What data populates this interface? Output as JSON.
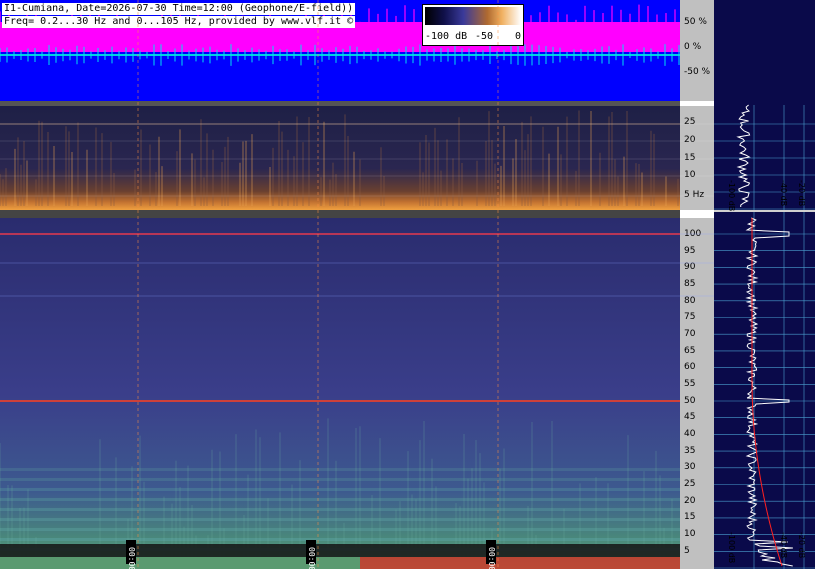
{
  "header": {
    "line1": "I1-Cumiana, Date=2026-07-30 Time=12:00 (Geophone/E-field))",
    "line2": "Freq= 0.2...30 Hz and 0...105 Hz, provided by www.vlf.it ©"
  },
  "colorbar": {
    "labels": [
      "-100 dB",
      "-50",
      "0"
    ]
  },
  "time_markers": [
    "00:00",
    "00:00",
    "00:00"
  ],
  "chart_data": [
    {
      "type": "line",
      "panel": "amplitude",
      "y_ticks": [
        "50 %",
        "0 %",
        "-50 %"
      ],
      "ylim": [
        -100,
        100
      ],
      "series": [],
      "colors": {
        "background": "#0000ff",
        "envelope": "#ff00ff",
        "trace": "#00d0e0"
      }
    },
    {
      "type": "heatmap",
      "panel": "spectrogram-low",
      "y_ticks": [
        "25",
        "20",
        "15",
        "10",
        "5 Hz"
      ],
      "ylim": [
        0.2,
        30
      ],
      "colormap": "dark-orange"
    },
    {
      "type": "heatmap",
      "panel": "spectrogram-high",
      "y_ticks": [
        "100",
        "95",
        "90",
        "85",
        "80",
        "75",
        "70",
        "65",
        "60",
        "55",
        "50",
        "45",
        "40",
        "35",
        "30",
        "25",
        "20",
        "15",
        "10",
        "5"
      ],
      "ylim": [
        0,
        105
      ],
      "colormap": "blue-green",
      "lines_hz": [
        100,
        50
      ]
    },
    {
      "type": "line",
      "panel": "spectrum-low",
      "x_labels": [
        "-100 dB",
        "-40 dB",
        "-20 dB"
      ],
      "colors": {
        "trace": "#ffffff",
        "average": "#ff0000"
      }
    },
    {
      "type": "line",
      "panel": "spectrum-high",
      "x_labels": [
        "-100 dB",
        "-40 dB",
        "-20 dB"
      ],
      "colors": {
        "trace": "#ffffff",
        "average": "#ff0000"
      }
    }
  ]
}
